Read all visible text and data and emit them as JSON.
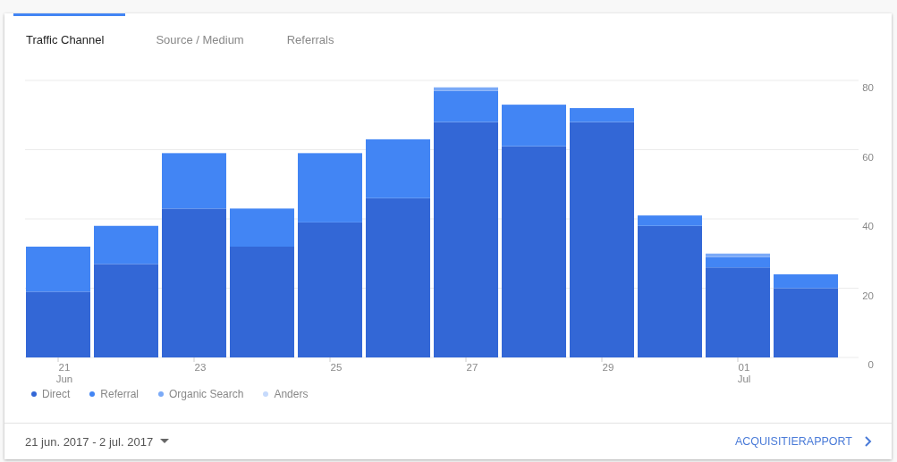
{
  "tabs": [
    {
      "label": "Traffic Channel",
      "selected": true
    },
    {
      "label": "Source / Medium",
      "selected": false
    },
    {
      "label": "Referrals",
      "selected": false
    }
  ],
  "chart_data": {
    "type": "bar",
    "stacked": true,
    "categories": [
      "21 Jun",
      null,
      "23",
      null,
      "25",
      null,
      "27",
      null,
      "29",
      null,
      "01 Jul",
      null
    ],
    "ylim": [
      0,
      80
    ],
    "grid": true,
    "yticks": [
      0,
      20,
      40,
      60,
      80
    ],
    "series": [
      {
        "name": "Direct",
        "color": "#3367d6",
        "values": [
          19,
          27,
          43,
          32,
          39,
          46,
          68,
          61,
          68,
          38,
          26,
          20
        ]
      },
      {
        "name": "Referral",
        "color": "#4285f4",
        "values": [
          13,
          11,
          16,
          11,
          20,
          17,
          9,
          12,
          4,
          3,
          3,
          4
        ]
      },
      {
        "name": "Organic Search",
        "color": "#7baaf7",
        "values": [
          0,
          0,
          0,
          0,
          0,
          0,
          1,
          0,
          0,
          0,
          1,
          0
        ]
      },
      {
        "name": "Anders",
        "color": "#c6dafc",
        "values": [
          0,
          0,
          0,
          0,
          0,
          0,
          0,
          0,
          0,
          0,
          0,
          0
        ]
      }
    ]
  },
  "date_range": "21 jun. 2017 - 2 jul. 2017",
  "report_link": "ACQUISITIERAPPORT"
}
